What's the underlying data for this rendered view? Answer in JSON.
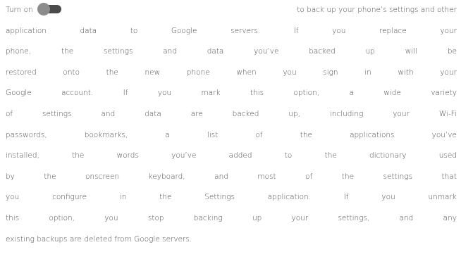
{
  "paragraph": {
    "line1_before_toggle": "Turn on",
    "line1_after_toggle": "to back up your phone’s settings and other",
    "toggle_icon": "toggle-switch-icon",
    "lines": [
      "application data to Google servers. If you replace your",
      "phone, the settings and data you’ve backed up will be",
      "restored onto the new phone when you sign in with your",
      "Google account. If you mark this option, a wide variety",
      "of settings and data are backed up, including your Wi-Fi",
      "passwords, bookmarks, a list of the applications you’ve",
      "installed, the words you’ve added to the dictionary used",
      "by the onscreen keyboard, and most of the settings that",
      "you configure in the Settings application. If you unmark",
      "this option, you stop backing up your settings, and any",
      "existing backups are deleted from Google servers."
    ]
  },
  "colors": {
    "text": "#4d4d4d",
    "toggle_track": "#4a4a4a",
    "toggle_thumb": "#8c8c8c"
  }
}
